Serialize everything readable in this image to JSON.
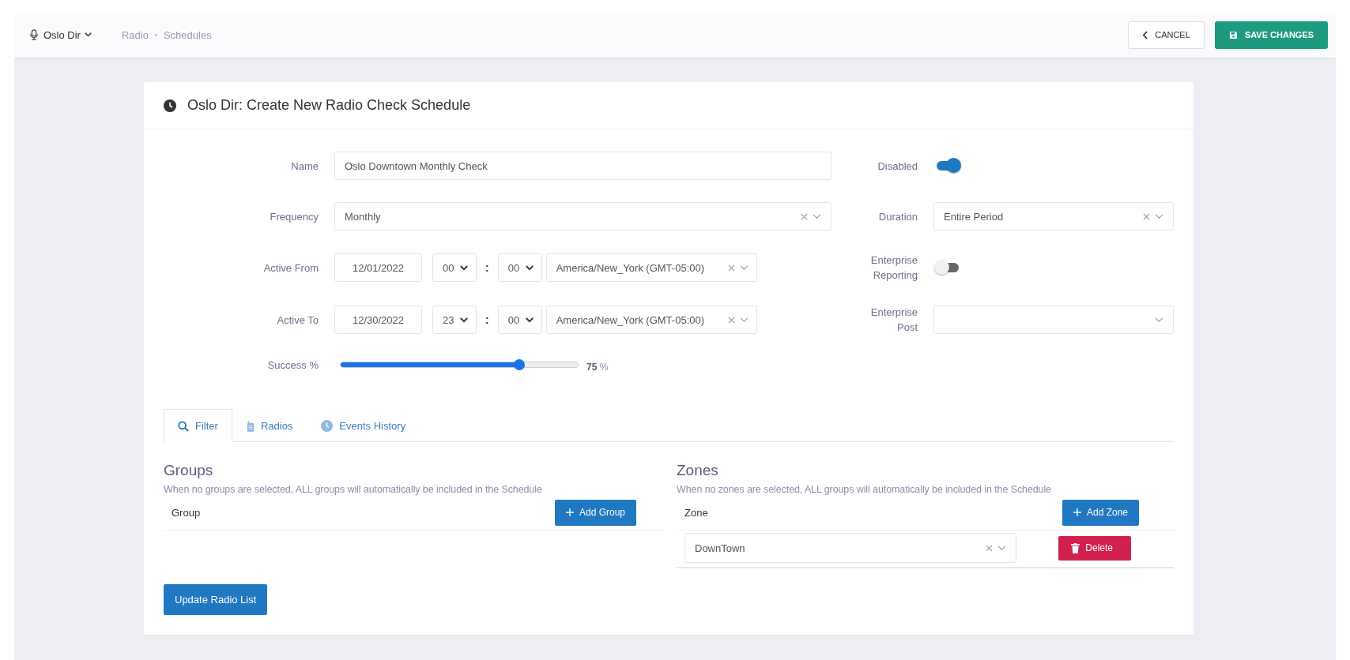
{
  "topbar": {
    "org": "Oslo Dir",
    "breadcrumb": [
      "Radio",
      "Schedules"
    ],
    "cancel": "CANCEL",
    "save": "SAVE CHANGES"
  },
  "card": {
    "title": "Oslo Dir: Create New Radio Check Schedule"
  },
  "form": {
    "name": {
      "label": "Name",
      "value": "Oslo Downtown Monthly Check"
    },
    "frequency": {
      "label": "Frequency",
      "value": "Monthly"
    },
    "active_from": {
      "label": "Active From",
      "date": "12/01/2022",
      "hour": "00",
      "separator": ":",
      "minute": "00",
      "timezone": "America/New_York (GMT-05:00)"
    },
    "active_to": {
      "label": "Active To",
      "date": "12/30/2022",
      "hour": "23",
      "separator": ":",
      "minute": "00",
      "timezone": "America/New_York (GMT-05:00)"
    },
    "success": {
      "label": "Success %",
      "level": 0.75,
      "reading": "75",
      "unit": "%"
    }
  },
  "settings": {
    "disabled": {
      "label": "Disabled",
      "on": true
    },
    "duration": {
      "label": "Duration",
      "value": "Entire Period"
    },
    "enterprise_reporting": {
      "label": "Enterprise Reporting",
      "on": false
    },
    "enterprise_post": {
      "label": "Enterprise Post"
    }
  },
  "tabs": [
    {
      "label": "Filter",
      "selected": true
    },
    {
      "label": "Radios",
      "selected": false
    },
    {
      "label": "Events History",
      "selected": false
    }
  ],
  "groups": {
    "title": "Groups",
    "hint": "When no groups are selected, ALL groups will automatically be included in the Schedule",
    "column": "Group",
    "add": "Add Group"
  },
  "zones": {
    "title": "Zones",
    "hint": "When no zones are selected, ALL groups will automatically be included in the Schedule",
    "column": "Zone",
    "add": "Add Zone",
    "rows": [
      {
        "value": "DownTown",
        "delete": "Delete"
      }
    ]
  },
  "update_button": "Update Radio List"
}
